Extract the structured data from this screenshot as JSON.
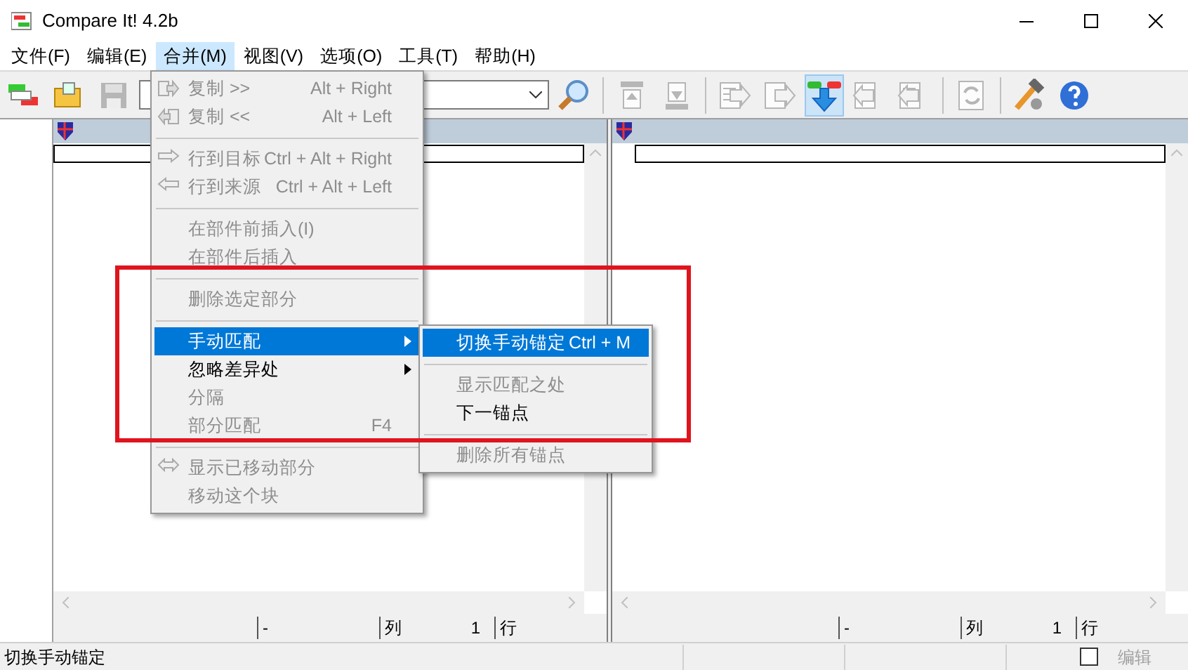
{
  "window": {
    "title": "Compare It! 4.2b"
  },
  "menubar": [
    {
      "label": "文件(F)",
      "selected": false
    },
    {
      "label": "编辑(E)",
      "selected": false
    },
    {
      "label": "合并(M)",
      "selected": true
    },
    {
      "label": "视图(V)",
      "selected": false
    },
    {
      "label": "选项(O)",
      "selected": false
    },
    {
      "label": "工具(T)",
      "selected": false
    },
    {
      "label": "帮助(H)",
      "selected": false
    }
  ],
  "toolbar": [
    {
      "kind": "compare",
      "selected": false,
      "disabled": false
    },
    {
      "kind": "open",
      "selected": false,
      "disabled": false
    },
    {
      "kind": "save",
      "selected": false,
      "disabled": true
    },
    {
      "kind": "combo"
    },
    {
      "kind": "search",
      "selected": false,
      "disabled": false
    },
    {
      "kind": "separator"
    },
    {
      "kind": "up",
      "selected": false,
      "disabled": true
    },
    {
      "kind": "down",
      "selected": false,
      "disabled": true
    },
    {
      "kind": "separator"
    },
    {
      "kind": "copy-right-all",
      "selected": false,
      "disabled": true
    },
    {
      "kind": "copy-right",
      "selected": false,
      "disabled": true
    },
    {
      "kind": "merge",
      "selected": true,
      "disabled": false
    },
    {
      "kind": "copy-left",
      "selected": false,
      "disabled": true
    },
    {
      "kind": "copy-left-all",
      "selected": false,
      "disabled": true
    },
    {
      "kind": "separator"
    },
    {
      "kind": "refresh",
      "selected": false,
      "disabled": true
    },
    {
      "kind": "separator"
    },
    {
      "kind": "tools",
      "selected": false,
      "disabled": false
    },
    {
      "kind": "help",
      "selected": false,
      "disabled": false
    }
  ],
  "panes": [
    {
      "info": [
        "-",
        "列",
        "1",
        "行"
      ]
    },
    {
      "info": [
        "-",
        "列",
        "1",
        "行"
      ]
    }
  ],
  "menu": {
    "items": [
      {
        "kind": "item",
        "label": "复制 >>",
        "shortcut": "Alt + Right",
        "disabled": true,
        "selected": false
      },
      {
        "kind": "item",
        "label": "复制 <<",
        "shortcut": "Alt + Left",
        "disabled": true,
        "selected": false
      },
      {
        "kind": "separator"
      },
      {
        "kind": "item",
        "label": "行到目标",
        "shortcut": "Ctrl + Alt + Right",
        "disabled": true,
        "selected": false
      },
      {
        "kind": "item",
        "label": "行到来源",
        "shortcut": "Ctrl + Alt + Left",
        "disabled": true,
        "selected": false
      },
      {
        "kind": "separator"
      },
      {
        "kind": "item",
        "label": "在部件前插入(I)",
        "disabled": true,
        "selected": false
      },
      {
        "kind": "item",
        "label": "在部件后插入",
        "disabled": true,
        "selected": false
      },
      {
        "kind": "separator"
      },
      {
        "kind": "item",
        "label": "删除选定部分",
        "disabled": true,
        "selected": false
      },
      {
        "kind": "separator"
      },
      {
        "kind": "item",
        "label": "手动匹配",
        "submenu": true,
        "disabled": false,
        "selected": true
      },
      {
        "kind": "item",
        "label": "忽略差异处",
        "submenu": true,
        "disabled": false,
        "selected": false
      },
      {
        "kind": "item",
        "label": "分隔",
        "disabled": true,
        "selected": false
      },
      {
        "kind": "item",
        "label": "部分匹配",
        "shortcut": "F4",
        "disabled": true,
        "selected": false
      },
      {
        "kind": "separator"
      },
      {
        "kind": "item",
        "label": "显示已移动部分",
        "disabled": true,
        "selected": false
      },
      {
        "kind": "item",
        "label": "移动这个块",
        "disabled": true,
        "selected": false
      }
    ]
  },
  "submenu": {
    "items": [
      {
        "kind": "item",
        "label": "切换手动锚定",
        "shortcut": "Ctrl + M",
        "disabled": false,
        "selected": true
      },
      {
        "kind": "separator"
      },
      {
        "kind": "item",
        "label": "显示匹配之处",
        "disabled": true,
        "selected": false
      },
      {
        "kind": "item",
        "label": "下一锚点",
        "disabled": false,
        "selected": false
      },
      {
        "kind": "separator"
      },
      {
        "kind": "item",
        "label": "删除所有锚点",
        "disabled": true,
        "selected": false
      }
    ]
  },
  "status_bar": {
    "text": "切换手动锚定",
    "checkbox": {
      "checked": false
    },
    "mode": {
      "label": "编辑",
      "disabled": true
    }
  }
}
